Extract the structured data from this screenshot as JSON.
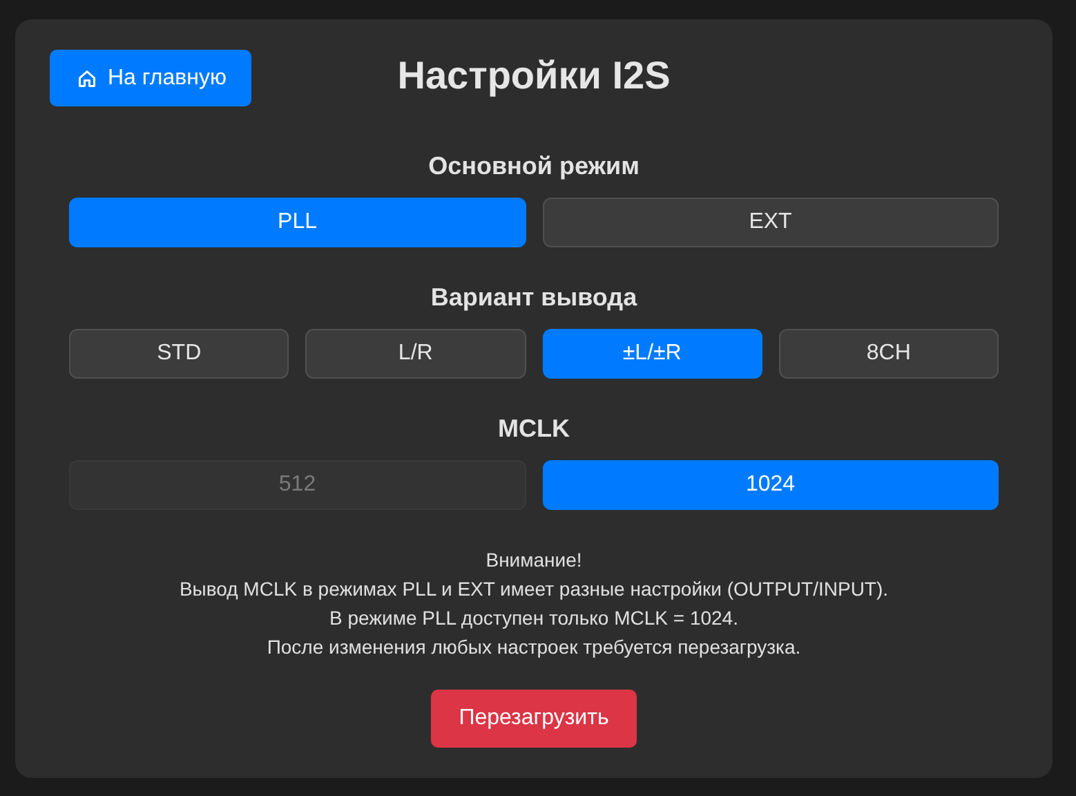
{
  "header": {
    "home_button": "На главную",
    "title": "Настройки I2S"
  },
  "sections": [
    {
      "title": "Основной режим",
      "options": [
        {
          "label": "PLL",
          "selected": true,
          "disabled": false
        },
        {
          "label": "EXT",
          "selected": false,
          "disabled": false
        }
      ]
    },
    {
      "title": "Вариант вывода",
      "options": [
        {
          "label": "STD",
          "selected": false,
          "disabled": false
        },
        {
          "label": "L/R",
          "selected": false,
          "disabled": false
        },
        {
          "label": "±L/±R",
          "selected": true,
          "disabled": false
        },
        {
          "label": "8CH",
          "selected": false,
          "disabled": false
        }
      ]
    },
    {
      "title": "MCLK",
      "options": [
        {
          "label": "512",
          "selected": false,
          "disabled": true
        },
        {
          "label": "1024",
          "selected": true,
          "disabled": false
        }
      ]
    }
  ],
  "notice": [
    "Внимание!",
    "Вывод MCLK в режимах PLL и EXT имеет разные настройки (OUTPUT/INPUT).",
    "В режиме PLL доступен только MCLK = 1024.",
    "После изменения любых настроек требуется перезагрузка."
  ],
  "reboot_button": "Перезагрузить"
}
